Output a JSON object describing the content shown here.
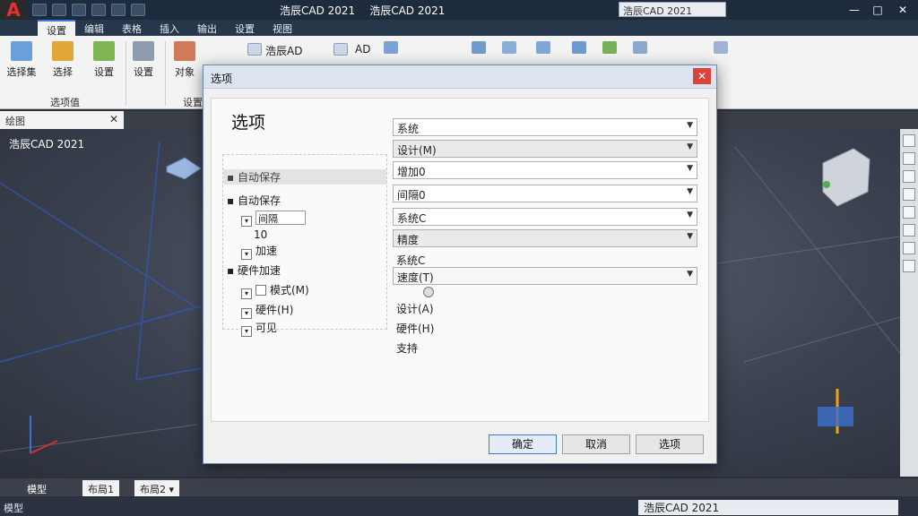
{
  "titlebar": {
    "logo": "A",
    "qa_labels": [
      "",
      "",
      "",
      "",
      ""
    ],
    "app_title": "浩辰CAD 2021",
    "app_title_alt": "浩辰CAD 2021",
    "search_text": "浩辰CAD 2021",
    "win_controls": [
      "—",
      "□",
      "✕"
    ]
  },
  "tabs": [
    "设置",
    "编辑",
    "表格",
    "插入",
    "输出",
    "设置",
    "视图"
  ],
  "ribbon": {
    "buttons": [
      {
        "label": "选择集",
        "icon": "select-icon"
      },
      {
        "label": "选择",
        "icon": "filter-icon"
      },
      {
        "label": "设置",
        "icon": "settings-icon"
      },
      {
        "label": "设置",
        "icon": "settings-icon"
      },
      {
        "label": "对象",
        "icon": "object-icon"
      }
    ],
    "panel_titles": [
      "选项值",
      "设置"
    ],
    "text_items": [
      "浩辰AD",
      "AD"
    ]
  },
  "file_tab": {
    "label": "绘图",
    "close": "✕"
  },
  "viewport": {
    "label": "浩辰CAD 2021"
  },
  "layout_tabs": [
    "模型",
    "布局1",
    "布局2 ▾"
  ],
  "status": {
    "left": "模型",
    "mid": "浩辰CAD 2021"
  },
  "dialog": {
    "title": "选项",
    "close": "✕",
    "heading": "选项",
    "tree": {
      "highlight": "自动保存",
      "section1": "自动保存",
      "item1_select": "间隔",
      "item1_sub": "10",
      "item2": "加速",
      "section2": "硬件加速",
      "item3": "模式(M)",
      "item4": "硬件(H)",
      "item5": "可见"
    },
    "combos": [
      {
        "text": "系统",
        "grey": false
      },
      {
        "text": "设计(M)",
        "grey": true
      },
      {
        "text": "增加0",
        "grey": false
      },
      {
        "text": "间隔0",
        "grey": false
      },
      {
        "text": "系统C",
        "grey": false
      },
      {
        "text": "精度",
        "grey": true
      }
    ],
    "plain": [
      "系统C",
      "设计(A)",
      "硬件(H)",
      "支持"
    ],
    "speed_combo": "速度(T)",
    "buttons": [
      "确定",
      "取消",
      "选项"
    ]
  },
  "colors": {
    "accent": "#3d7bd0",
    "titlebar": "#1e2b3d",
    "close": "#d9453b"
  }
}
